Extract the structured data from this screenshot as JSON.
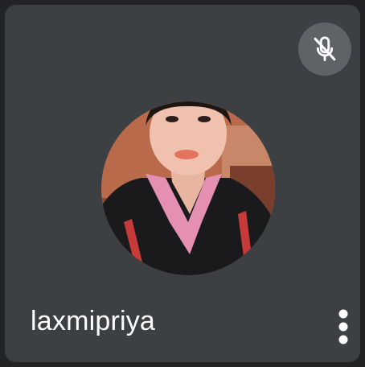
{
  "participant": {
    "name": "laxmipriya",
    "mic_status_icon": "mic-off-icon",
    "menu_icon": "more-vert-icon"
  },
  "colors": {
    "tile_background": "#3c4043",
    "mute_button": "#5f6368",
    "text": "#ffffff"
  }
}
